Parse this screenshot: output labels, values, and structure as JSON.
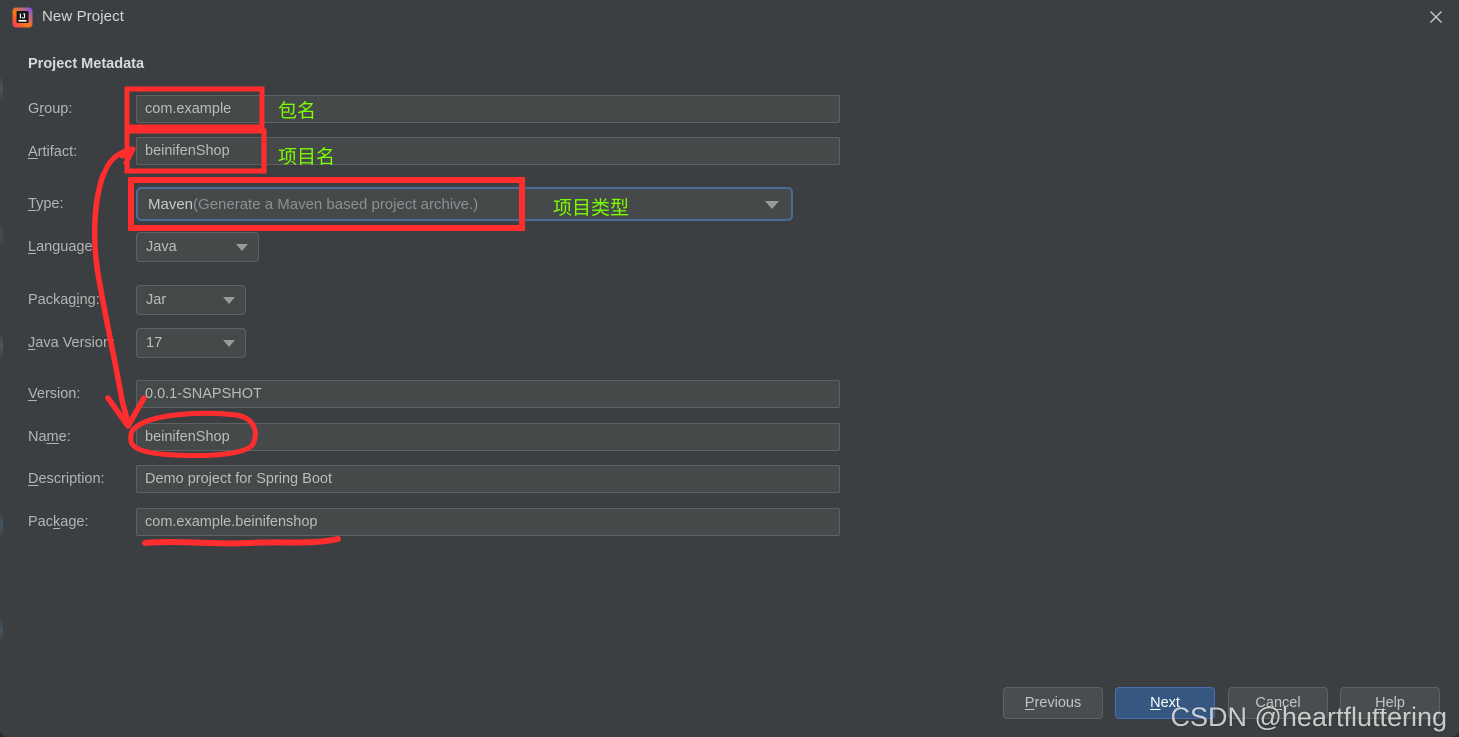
{
  "window": {
    "title": "New Project",
    "app_icon": "intellij-idea-icon",
    "close_icon": "close-icon"
  },
  "section": {
    "title": "Project Metadata"
  },
  "form": {
    "fields": [
      {
        "label_pre": "G",
        "label_mn": "r",
        "label_post": "oup:",
        "label": "Group:",
        "value": "com.example",
        "kind": "text"
      },
      {
        "label_pre": "",
        "label_mn": "A",
        "label_post": "rtifact:",
        "label": "Artifact:",
        "value": "beinifenShop",
        "kind": "text"
      },
      {
        "label_pre": "",
        "label_mn": "T",
        "label_post": "ype:",
        "label": "Type:",
        "value": "Maven",
        "hint": " (Generate a Maven based project archive.)",
        "kind": "combo-focused"
      },
      {
        "label_pre": "",
        "label_mn": "L",
        "label_post": "anguage:",
        "label": "Language:",
        "value": "Java",
        "kind": "combo"
      },
      {
        "label_pre": "Packag",
        "label_mn": "i",
        "label_post": "ng:",
        "label": "Packaging:",
        "value": "Jar",
        "kind": "combo"
      },
      {
        "label_pre": "",
        "label_mn": "J",
        "label_post": "ava Version:",
        "label": "Java Version:",
        "value": "17",
        "kind": "combo"
      },
      {
        "label_pre": "",
        "label_mn": "V",
        "label_post": "ersion:",
        "label": "Version:",
        "value": "0.0.1-SNAPSHOT",
        "kind": "text"
      },
      {
        "label_pre": "Na",
        "label_mn": "m",
        "label_post": "e:",
        "label": "Name:",
        "value": "beinifenShop",
        "kind": "text"
      },
      {
        "label_pre": "",
        "label_mn": "D",
        "label_post": "escription:",
        "label": "Description:",
        "value": "Demo project for Spring Boot",
        "kind": "text"
      },
      {
        "label_pre": "Pac",
        "label_mn": "k",
        "label_post": "age:",
        "label": "Package:",
        "value": "com.example.beinifenshop",
        "kind": "text"
      }
    ]
  },
  "annotations": {
    "color_box": "#ff2d2d",
    "color_note": "#7cfc00",
    "notes": [
      {
        "text": "包名",
        "meaning": "package-name"
      },
      {
        "text": "项目名",
        "meaning": "project-name"
      },
      {
        "text": "项目类型",
        "meaning": "project-type"
      }
    ]
  },
  "buttons": [
    {
      "label_pre": "",
      "label_mn": "P",
      "label_post": "revious",
      "label": "Previous",
      "primary": false
    },
    {
      "label_pre": "",
      "label_mn": "N",
      "label_post": "ext",
      "label": "Next",
      "primary": true
    },
    {
      "label_pre": "Ca",
      "label_mn": "n",
      "label_post": "cel",
      "label": "Cancel",
      "primary": false
    },
    {
      "label_pre": "",
      "label_mn": "H",
      "label_post": "elp",
      "label": "Help",
      "primary": false
    }
  ],
  "watermark": {
    "text": "CSDN @heartfluttering"
  }
}
